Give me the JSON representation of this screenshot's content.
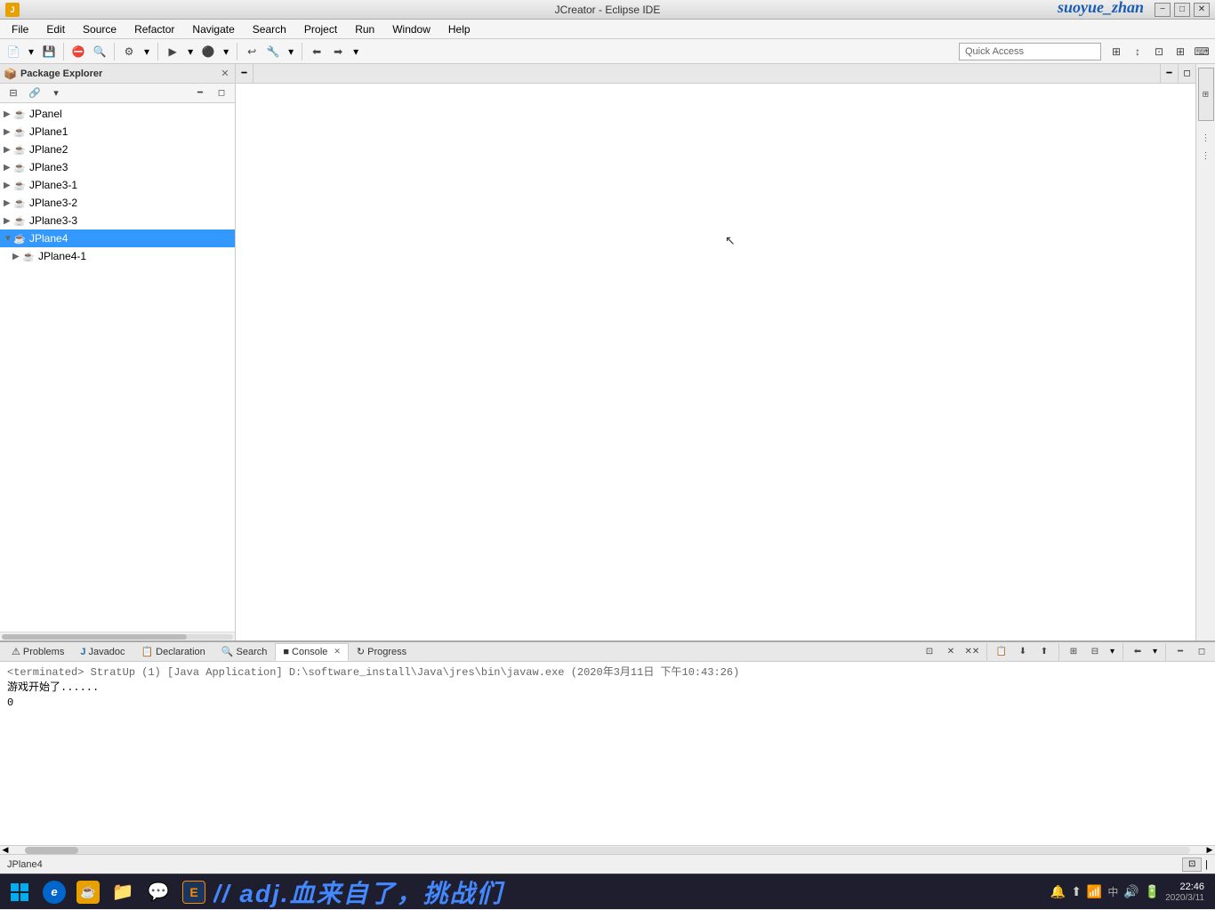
{
  "titlebar": {
    "title": "JCreator - Eclipse IDE",
    "watermark": "suoyue_zhan",
    "minimize": "−",
    "maximize": "□",
    "close": "✕"
  },
  "menubar": {
    "items": [
      "File",
      "Edit",
      "Source",
      "Refactor",
      "Navigate",
      "Search",
      "Project",
      "Run",
      "Window",
      "Help"
    ]
  },
  "toolbar": {
    "quick_access_placeholder": "Quick Access",
    "quick_access_label": "Quick Access"
  },
  "package_explorer": {
    "title": "Package Explorer",
    "items": [
      {
        "label": "JPanel",
        "indent": 0,
        "has_arrow": true,
        "expanded": false
      },
      {
        "label": "JPlane1",
        "indent": 0,
        "has_arrow": true,
        "expanded": false
      },
      {
        "label": "JPlane2",
        "indent": 0,
        "has_arrow": true,
        "expanded": false
      },
      {
        "label": "JPlane3",
        "indent": 0,
        "has_arrow": true,
        "expanded": false
      },
      {
        "label": "JPlane3-1",
        "indent": 0,
        "has_arrow": true,
        "expanded": false
      },
      {
        "label": "JPlane3-2",
        "indent": 0,
        "has_arrow": true,
        "expanded": false
      },
      {
        "label": "JPlane3-3",
        "indent": 0,
        "has_arrow": true,
        "expanded": false
      },
      {
        "label": "JPlane4",
        "indent": 0,
        "has_arrow": true,
        "expanded": true,
        "selected": true
      },
      {
        "label": "JPlane4-1",
        "indent": 1,
        "has_arrow": true,
        "expanded": false
      }
    ]
  },
  "bottom_tabs": [
    {
      "label": "Problems",
      "icon": "⚠",
      "active": false
    },
    {
      "label": "Javadoc",
      "icon": "J",
      "active": false
    },
    {
      "label": "Declaration",
      "icon": "D",
      "active": false
    },
    {
      "label": "Search",
      "icon": "🔍",
      "active": false
    },
    {
      "label": "Console",
      "icon": "■",
      "active": true
    },
    {
      "label": "Progress",
      "icon": "↻",
      "active": false
    }
  ],
  "console": {
    "terminated_line": "<terminated> StratUp (1) [Java Application] D:\\software_install\\Java\\jres\\bin\\javaw.exe (2020年3月11日 下午10:43:26)",
    "output_lines": [
      "游戏开始了......",
      "0"
    ]
  },
  "status_bar": {
    "project": "JPlane4"
  },
  "taskbar": {
    "chinese_text": "// adj.血来自了，挑战们",
    "clock": "22:46",
    "date": "2020/3/11"
  },
  "icons": {
    "java_project": "☕",
    "arrow_collapsed": "▶",
    "arrow_expanded": "▼",
    "minimize": "━",
    "restore": "◻",
    "close": "✕"
  }
}
